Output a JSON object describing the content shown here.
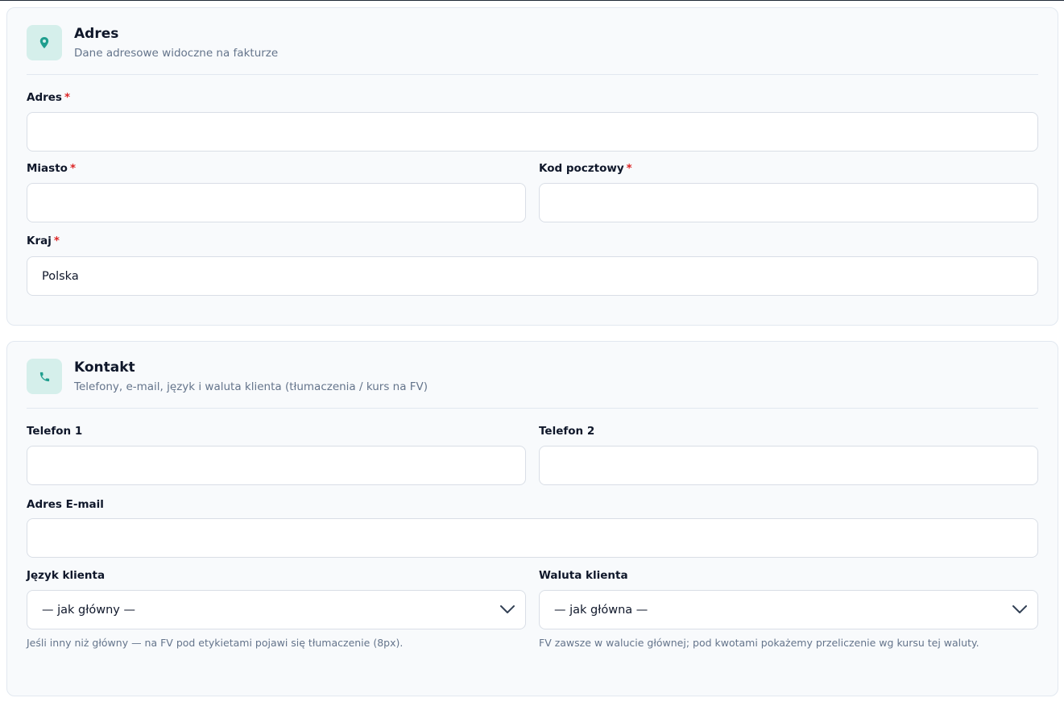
{
  "colors": {
    "accent": "#1f9e8e",
    "icon_bg": "#d5efeb",
    "required": "#dc2626",
    "card_bg": "#f8fafc"
  },
  "adres": {
    "icon": "map-pin-icon",
    "title": "Adres",
    "subtitle": "Dane adresowe widoczne na fakturze",
    "fields": {
      "adres": {
        "label": "Adres",
        "required": "*",
        "value": ""
      },
      "miasto": {
        "label": "Miasto",
        "required": "*",
        "value": ""
      },
      "kod": {
        "label": "Kod pocztowy",
        "required": "*",
        "value": ""
      },
      "kraj": {
        "label": "Kraj",
        "required": "*",
        "value": "Polska"
      }
    }
  },
  "kontakt": {
    "icon": "phone-icon",
    "title": "Kontakt",
    "subtitle": "Telefony, e-mail, język i waluta klienta (tłumaczenia / kurs na FV)",
    "fields": {
      "telefon1": {
        "label": "Telefon 1",
        "value": ""
      },
      "telefon2": {
        "label": "Telefon 2",
        "value": ""
      },
      "email": {
        "label": "Adres E-mail",
        "value": ""
      },
      "jezyk": {
        "label": "Język klienta",
        "selected": "— jak główny —",
        "hint": "Jeśli inny niż główny — na FV pod etykietami pojawi się tłumaczenie (8px)."
      },
      "waluta": {
        "label": "Waluta klienta",
        "selected": "— jak główna —",
        "hint": "FV zawsze w walucie głównej; pod kwotami pokażemy przeliczenie wg kursu tej waluty."
      }
    }
  }
}
